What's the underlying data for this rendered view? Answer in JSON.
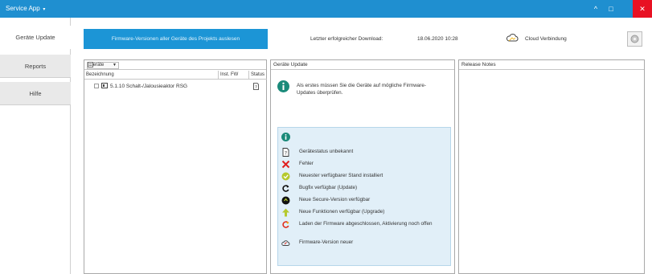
{
  "window": {
    "title": "Service App"
  },
  "sidebar": {
    "items": [
      {
        "label": "Geräte Update"
      },
      {
        "label": "Reports"
      },
      {
        "label": "Hilfe"
      }
    ]
  },
  "topbar": {
    "firmware_button": "Firmware-Versionen aller Geräte des Projekts auslesen",
    "last_download_label": "Letzter erfolgreicher Download:",
    "last_download_value": "18.06.2020 10:28",
    "cloud_label": "Cloud Verbindung"
  },
  "devices_panel": {
    "filter": "Geräte",
    "columns": [
      "Bezeichnung",
      "Inst. FW",
      "Status"
    ],
    "rows": [
      {
        "name": "5.1.10 Schalt-/Jalousieaktor RSG"
      }
    ]
  },
  "update_panel": {
    "title": "Geräte Update",
    "message": "Als erstes müssen Sie die Geräte auf mögliche Firmware-Updates überprüfen.",
    "legend": [
      {
        "icon": "status-unknown-icon",
        "label": "Gerätestatus unbekannt"
      },
      {
        "icon": "error-icon",
        "label": "Fehler"
      },
      {
        "icon": "installed-icon",
        "label": "Neuester verfügbarer Stand installiert"
      },
      {
        "icon": "bugfix-icon",
        "label": "Bugfix verfügbar (Update)"
      },
      {
        "icon": "secure-icon",
        "label": "Neue Secure-Version verfügbar"
      },
      {
        "icon": "upgrade-icon",
        "label": "Neue Funktionen verfügbar (Upgrade)"
      },
      {
        "icon": "loading-icon",
        "label": "Laden der Firmware abgeschlossen, Aktivierung noch offen"
      },
      {
        "icon": "cloud-newer-icon",
        "label": "Firmware-Version neuer"
      }
    ]
  },
  "release_panel": {
    "title": "Release Notes"
  },
  "colors": {
    "titlebar": "#1f8fd0",
    "button": "#1c95d6",
    "legend_bg": "#e1eff8",
    "info": "#1a8a7a"
  }
}
